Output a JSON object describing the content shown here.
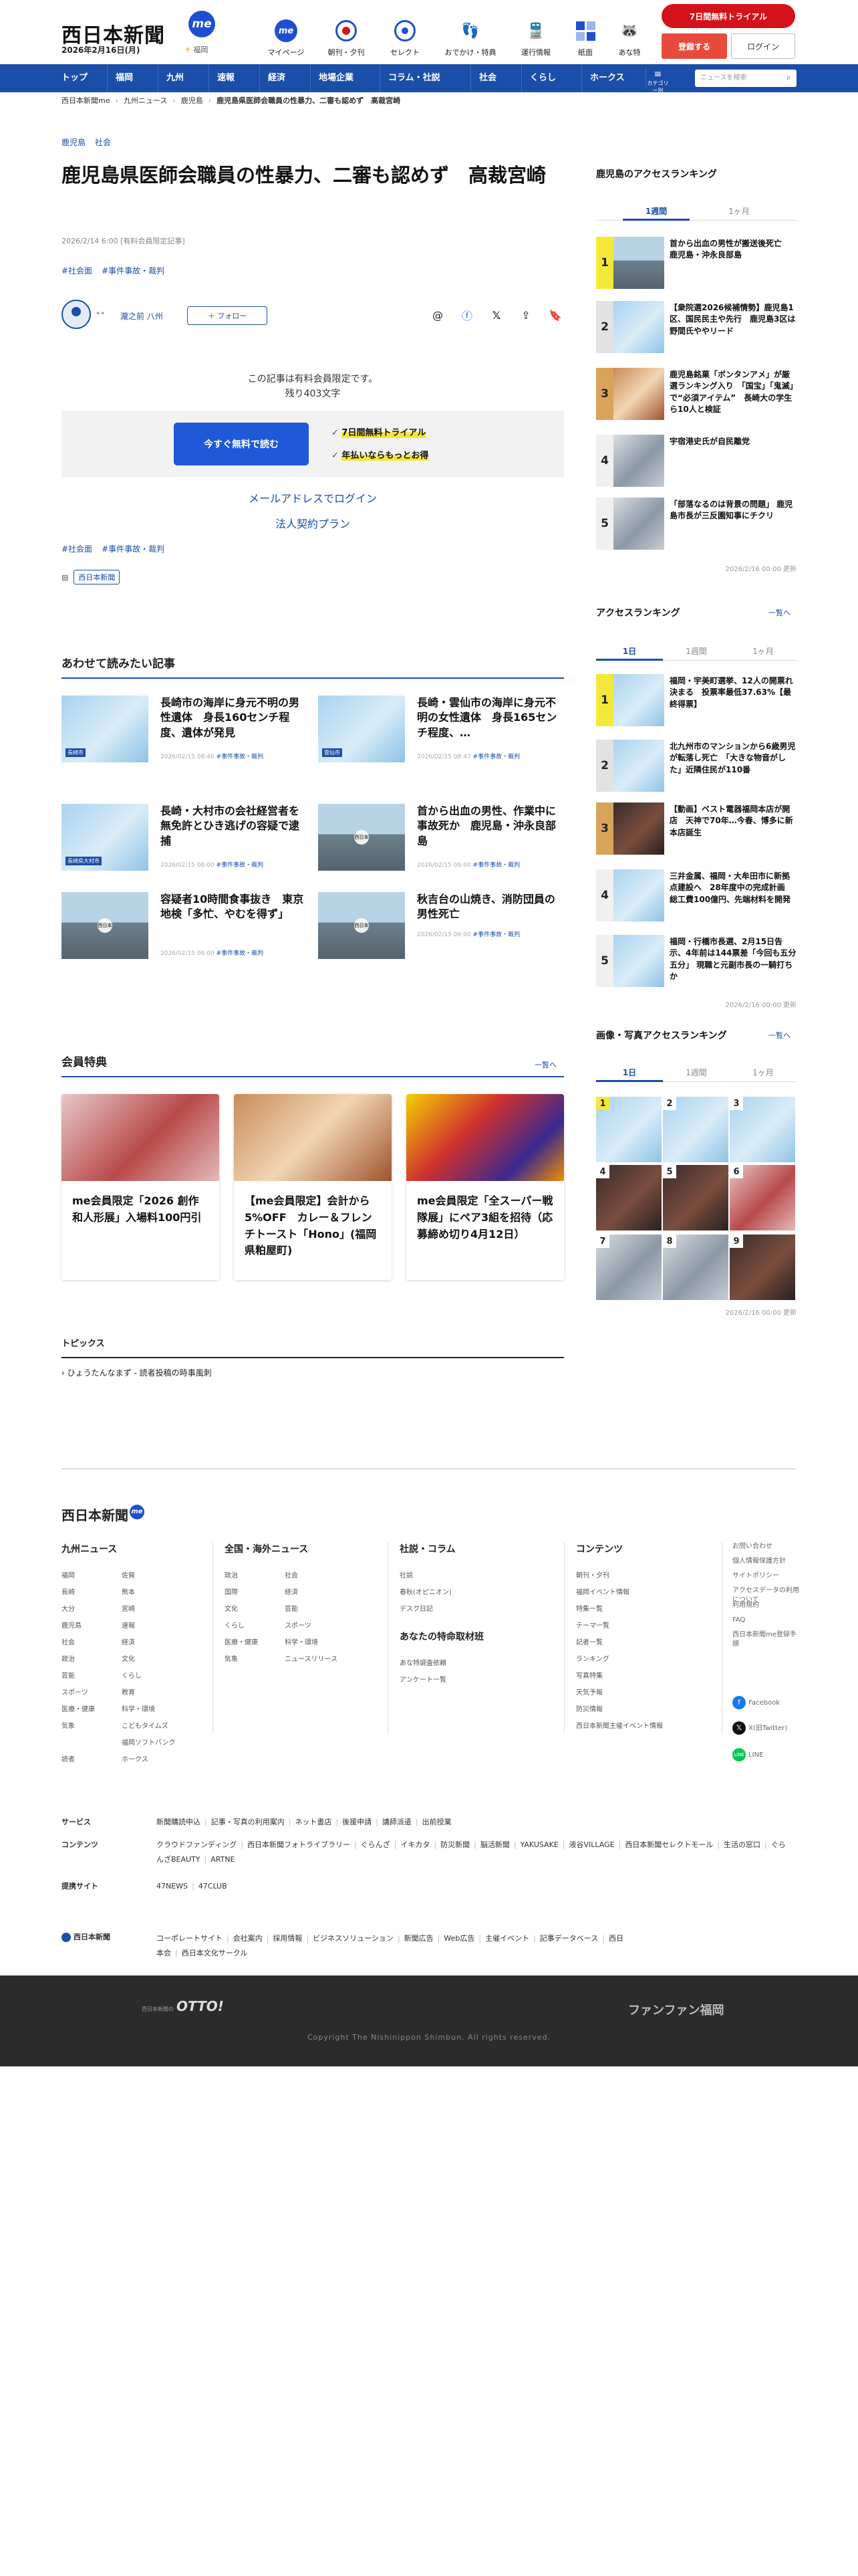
{
  "header": {
    "logo": "西日本新聞",
    "logo_badge": "me",
    "date": "2026年2月16日(月)",
    "weather_city": "福岡",
    "nav": [
      {
        "label": "マイページ",
        "icon": "me-icon"
      },
      {
        "label": "朝刊・夕刊",
        "icon": "newspaper-icon"
      },
      {
        "label": "セレクト",
        "icon": "select-icon"
      },
      {
        "label": "おでかけ・特典",
        "icon": "footprints-icon"
      },
      {
        "label": "運行情報",
        "icon": "train-icon"
      },
      {
        "label": "紙面",
        "icon": "page-grid-icon"
      },
      {
        "label": "あな特",
        "icon": "raccoon-icon"
      }
    ],
    "trial_label": "7日間無料トライアル",
    "register_label": "登録する",
    "login_label": "ログイン"
  },
  "navbar": {
    "items": [
      "トップ",
      "福岡",
      "九州",
      "速報",
      "経済",
      "地場企業",
      "コラム・社説",
      "社会",
      "くらし",
      "ホークス"
    ],
    "category_label": "カテゴリー別",
    "search_placeholder": "ニュースを検索"
  },
  "breadcrumb": [
    "西日本新聞me",
    "九州ニュース",
    "鹿児島",
    "鹿児島県医師会職員の性暴力、二審も認めず　高裁宮崎"
  ],
  "article": {
    "tags": [
      "鹿児島",
      "社会"
    ],
    "title": "鹿児島県医師会職員の性暴力、二審も認めず　高裁宮崎",
    "published": "2026/2/14 6:00 [有料会員限定記事]",
    "hashtags": [
      "#社会面",
      "#事件事故・裁判"
    ],
    "author": "瀧之前 八州",
    "follow_label": "＋ フォロー",
    "paywall_line1": "この記事は有料会員限定です。",
    "paywall_line2": "残り403文字",
    "read_free_label": "今すぐ無料で読む",
    "benefits": [
      "7日間無料トライアル",
      "年払いならもっとお得"
    ],
    "mail_login": "メールアドレスでログイン",
    "corporate": "法人契約プラン",
    "provider_label": "西日本新聞"
  },
  "related": {
    "heading": "あわせて読みたい記事",
    "items": [
      {
        "title": "長崎市の海岸に身元不明の男性遺体　身長160センチ程度、遺体が発見",
        "date": "2026/02/15 08:46",
        "tag": "#事件事故・裁判",
        "chip": "長崎市"
      },
      {
        "title": "長崎・雲仙市の海岸に身元不明の女性遺体　身長165センチ程度、…",
        "date": "2026/02/15 08:47",
        "tag": "#事件事故・裁判",
        "chip": "雲仙市"
      },
      {
        "title": "長崎・大村市の会社経営者を無免許とひき逃げの容疑で逮捕",
        "date": "2026/02/15 06:00",
        "tag": "#事件事故・裁判",
        "chip": "長崎県大村市"
      },
      {
        "title": "首から出血の男性、作業中に事故死か　鹿児島・沖永良部島",
        "date": "2026/02/15 06:00",
        "tag": "#事件事故・裁判",
        "chip": ""
      },
      {
        "title": "容疑者10時間食事抜き　東京地検「多忙、やむを得ず」",
        "date": "2026/02/15 06:00",
        "tag": "#事件事故・裁判",
        "chip": ""
      },
      {
        "title": "秋吉台の山焼き、消防団員の男性死亡",
        "date": "2026/02/15 06:00",
        "tag": "#事件事故・裁判",
        "chip": ""
      }
    ]
  },
  "members": {
    "heading": "会員特典",
    "more": "一覧へ",
    "items": [
      {
        "title": "me会員限定「2026 創作和人形展」入場料100円引"
      },
      {
        "title": "【me会員限定】会計から5%OFF　カレー＆フレンチトースト「Hono」(福岡県粕屋町)"
      },
      {
        "title": "me会員限定「全スーパー戦隊展」にペア3組を招待（応募締め切り4月12日）"
      }
    ]
  },
  "topics": {
    "heading": "トピックス",
    "item": "ひょうたんなまず - 読者投稿の時事風刺"
  },
  "sidebar": {
    "local_heading": "鹿児島のアクセスランキング",
    "local_tabs": [
      "1週間",
      "1ヶ月"
    ],
    "local_items": [
      "首から出血の男性が搬送後死亡　鹿児島・沖永良部島",
      "【衆院選2026候補情勢】鹿児島1区、国民民主や先行　鹿児島3区は野間氏ややリード",
      "鹿児島銘菓「ボンタンアメ」が厳選ランキング入り　「国宝」「鬼滅」で“必須アイテム”　長崎大の学生ら10人と検証",
      "宇宿港史氏が自民離党",
      "「部落なるのは背景の問題」 鹿児島市長が三反園知事にチクリ"
    ],
    "local_updated": "2026/2/16 00:00 更新",
    "access_heading": "アクセスランキング",
    "access_more": "一覧へ",
    "access_tabs": [
      "1日",
      "1週間",
      "1ヶ月"
    ],
    "access_items": [
      "福岡・宇美町選挙、12人の開票れ決まる　投票率最低37.63%【最終得票】",
      "北九州市のマンションから6歳男児が転落し死亡　「大きな物音がした」近隣住民が110番",
      "【動画】ベスト電器福岡本店が開店　天神で70年…今春、博多に新本店誕生",
      "三井金属、福岡・大牟田市に新拠点建設へ　28年度中の完成計画　総工費100億円、先端材料を開発",
      "福岡・行橋市長選、2月15日告示、4年前は144票差「今回も五分五分」 現職と元副市長の一騎打ちか"
    ],
    "access_updated": "2026/2/16 00:00 更新",
    "photo_heading": "画像・写真アクセスランキング",
    "photo_more": "一覧へ",
    "photo_tabs": [
      "1日",
      "1週間",
      "1ヶ月"
    ],
    "photo_nums": [
      "1",
      "2",
      "3",
      "4",
      "5",
      "6",
      "7",
      "8",
      "9"
    ],
    "photo_updated": "2026/2/16 00:00 更新"
  },
  "footer": {
    "logo": "西日本新聞",
    "logo_badge": "me",
    "cols": [
      {
        "heading": "九州ニュース",
        "links": [
          "福岡",
          "佐賀",
          "長崎",
          "熊本",
          "大分",
          "宮崎",
          "鹿児島",
          "速報",
          "社会",
          "経済",
          "政治",
          "文化",
          "芸能",
          "くらし",
          "スポーツ",
          "教育",
          "医療・健康",
          "科学・環境",
          "気象",
          "こどもタイムズ",
          "読者",
          "福岡ソフトバンクホークス"
        ]
      },
      {
        "heading": "全国・海外ニュース",
        "links": [
          "政治",
          "社会",
          "国際",
          "経済",
          "文化",
          "芸能",
          "くらし",
          "スポーツ",
          "医療・健康",
          "科学・環境",
          "気象",
          "ニュースリリース"
        ]
      },
      {
        "heading": "社説・コラム",
        "links": [
          "社説",
          "春秋(オピニオン)",
          "デスク日記"
        ],
        "heading2": "あなたの特命取材班",
        "links2": [
          "あな特調査依頼",
          "アンケート一覧"
        ]
      },
      {
        "heading": "コンテンツ",
        "links": [
          "朝刊・夕刊",
          "福岡イベント情報",
          "特集一覧",
          "テーマ一覧",
          "記者一覧",
          "ランキング",
          "写真特集",
          "天気予報",
          "防災情報",
          "西日本新聞主催イベント情報"
        ]
      }
    ],
    "extra": [
      "お問い合わせ",
      "個人情報保護方針",
      "サイトポリシー",
      "アクセスデータの利用について",
      "利用規約",
      "FAQ",
      "西日本新聞me登録手順"
    ],
    "social": [
      {
        "label": "Facebook",
        "icon": "facebook-icon",
        "color": "#1877f2"
      },
      {
        "label": "X(旧Twitter)",
        "icon": "x-icon",
        "color": "#111111"
      },
      {
        "label": "LINE",
        "icon": "line-icon",
        "color": "#06c755"
      }
    ],
    "services_label": "サービス",
    "services": [
      "新聞購読申込",
      "記事・写真の利用案内",
      "ネット書店",
      "後援申請",
      "講師派遣",
      "出前授業"
    ],
    "contents_label": "コンテンツ",
    "contents": [
      "クラウドファンディング",
      "西日本新聞フォトライブラリー",
      "ぐらんざ",
      "イキカタ",
      "防災新聞",
      "脳活新聞",
      "YAKUSAKE",
      "液谷VILLAGE",
      "西日本新聞セレクトモール",
      "生活の窓口",
      "ぐらんざBEAUTY",
      "ARTNE"
    ],
    "partners_label": "提携サイト",
    "partners": [
      "47NEWS",
      "47CLUB"
    ],
    "corp_label": "西日本新聞",
    "corp_links": [
      "コーポレートサイト",
      "会社案内",
      "採用情報",
      "ビジネスソリューション",
      "新聞広告",
      "Web広告",
      "主催イベント",
      "記事データベース",
      "西日本会",
      "西日本文化サークル"
    ],
    "otto_small": "西日本新聞の",
    "otto": "OTTO!",
    "funfan": "ファンファン福岡",
    "copyright": "Copyright The Nishinippon Shimbun. All rights reserved."
  },
  "colors": {
    "brand_blue": "#1b4ea8",
    "accent_red": "#d4121a",
    "register_red": "#e84b3c",
    "cta_blue": "#1f58d8",
    "highlight_yellow": "#f5e73a"
  }
}
